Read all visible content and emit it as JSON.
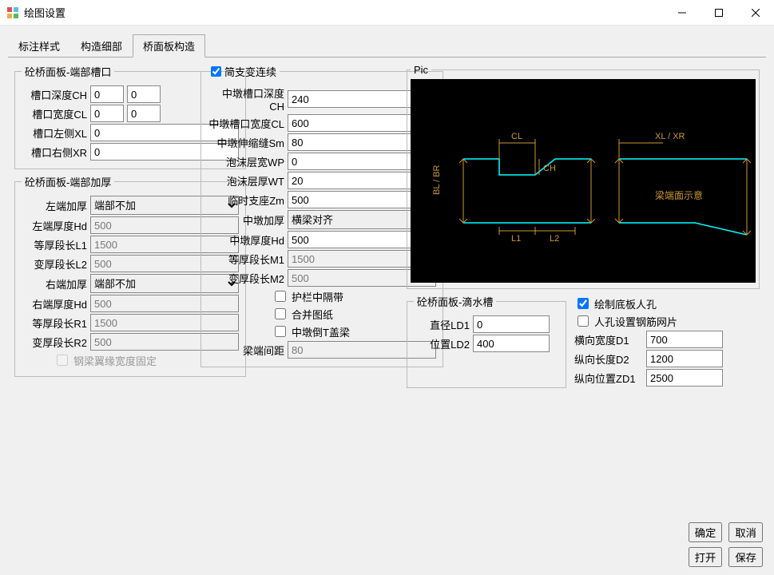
{
  "window": {
    "title": "绘图设置"
  },
  "tabs": {
    "items": [
      {
        "label": "标注样式"
      },
      {
        "label": "构造细部"
      },
      {
        "label": "桥面板构造"
      }
    ],
    "active": 2
  },
  "groove": {
    "legend": "砼桥面板-端部槽口",
    "ch_label": "槽口深度CH",
    "ch_v1": "0",
    "ch_v2": "0",
    "cl_label": "槽口宽度CL",
    "cl_v1": "0",
    "cl_v2": "0",
    "xl_label": "槽口左侧XL",
    "xl_v": "0",
    "xr_label": "槽口右侧XR",
    "xr_v": "0"
  },
  "thicken": {
    "legend": "砼桥面板-端部加厚",
    "left_mode_label": "左端加厚",
    "left_mode_value": "端部不加",
    "hd_l_label": "左端厚度Hd",
    "hd_l_v": "500",
    "l1_label": "等厚段长L1",
    "l1_v": "1500",
    "l2_label": "变厚段长L2",
    "l2_v": "500",
    "right_mode_label": "右端加厚",
    "right_mode_value": "端部不加",
    "hd_r_label": "右端厚度Hd",
    "hd_r_v": "500",
    "r1_label": "等厚段长R1",
    "r1_v": "1500",
    "r2_label": "变厚段长R2",
    "r2_v": "500",
    "flange_fixed_label": "钢梁翼缘宽度固定"
  },
  "cont": {
    "legend": "简支变连续",
    "ch_label": "中墩槽口深度CH",
    "ch_v": "240",
    "cl_label": "中墩槽口宽度CL",
    "cl_v": "600",
    "sm_label": "中墩伸缩缝Sm",
    "sm_v": "80",
    "wp_label": "泡沫层宽WP",
    "wp_v": "0",
    "wt_label": "泡沫层厚WT",
    "wt_v": "20",
    "zm_label": "临时支座Zm",
    "zm_v": "500",
    "mid_mode_label": "中墩加厚",
    "mid_mode_value": "横梁对齐",
    "hd_label": "中墩厚度Hd",
    "hd_v": "500",
    "m1_label": "等厚段长M1",
    "m1_v": "1500",
    "m2_label": "变厚段长M2",
    "m2_v": "500",
    "chk_guard_label": "护栏中隔带",
    "chk_merge_label": "合并图纸",
    "chk_reverse_label": "中墩倒T盖梁",
    "gap_label": "梁端间距",
    "gap_v": "80"
  },
  "pic": {
    "legend": "Pic"
  },
  "drip": {
    "legend": "砼桥面板-滴水槽",
    "ld1_label": "直径LD1",
    "ld1_v": "0",
    "ld2_label": "位置LD2",
    "ld2_v": "400"
  },
  "hole": {
    "chk_draw_label": "绘制底板人孔",
    "chk_mesh_label": "人孔设置钢筋网片",
    "d1_label": "横向宽度D1",
    "d1_v": "700",
    "d2_label": "纵向长度D2",
    "d2_v": "1200",
    "zd1_label": "纵向位置ZD1",
    "zd1_v": "2500"
  },
  "buttons": {
    "ok": "确定",
    "cancel": "取消",
    "open": "打开",
    "save": "保存"
  }
}
